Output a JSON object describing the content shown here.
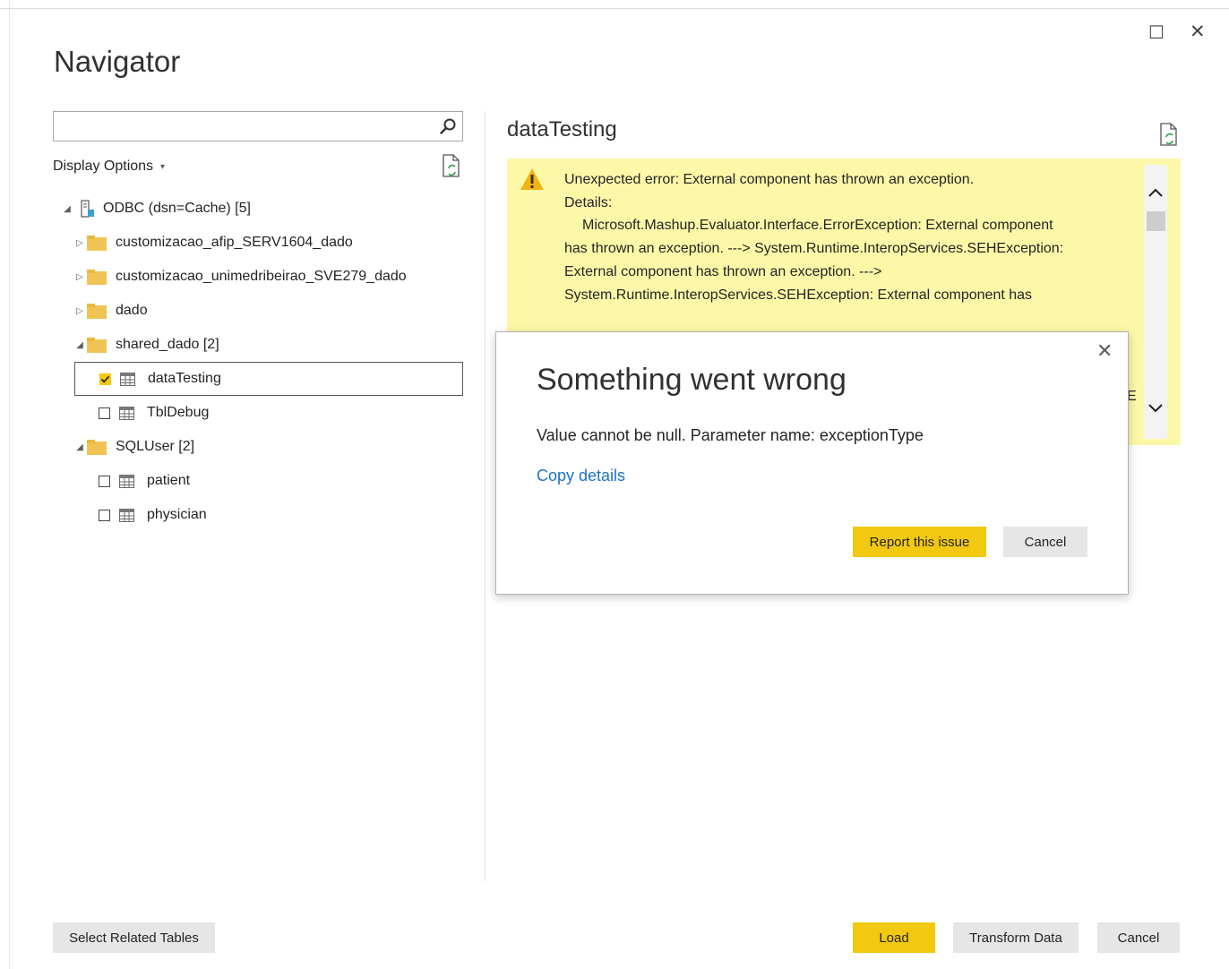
{
  "window": {
    "title": "Navigator",
    "maximize_label": "☐",
    "close_label": "✕"
  },
  "left_pane": {
    "search": {
      "value": "",
      "placeholder": ""
    },
    "display_options_label": "Display Options",
    "tree": [
      {
        "label": "ODBC (dsn=Cache) [5]",
        "kind": "source",
        "expanded": true,
        "level": 0
      },
      {
        "label": "customizacao_afip_SERV1604_dado",
        "kind": "folder",
        "expanded": false,
        "level": 1
      },
      {
        "label": "customizacao_unimedribeirao_SVE279_dado",
        "kind": "folder",
        "expanded": false,
        "level": 1
      },
      {
        "label": "dado",
        "kind": "folder",
        "expanded": false,
        "level": 1
      },
      {
        "label": "shared_dado [2]",
        "kind": "folder",
        "expanded": true,
        "level": 1
      },
      {
        "label": "dataTesting",
        "kind": "table",
        "checked": true,
        "selected": true,
        "level": 2
      },
      {
        "label": "TblDebug",
        "kind": "table",
        "checked": false,
        "level": 2
      },
      {
        "label": "SQLUser [2]",
        "kind": "folder",
        "expanded": true,
        "level": 1
      },
      {
        "label": "patient",
        "kind": "table",
        "checked": false,
        "level": 2
      },
      {
        "label": "physician",
        "kind": "table",
        "checked": false,
        "level": 2
      }
    ]
  },
  "preview": {
    "title": "dataTesting",
    "error_lines": [
      "Unexpected error: External component has thrown an exception.",
      "Details:",
      "Microsoft.Mashup.Evaluator.Interface.ErrorException: External component",
      "has thrown an exception. ---> System.Runtime.InteropServices.SEHException:",
      "External component has thrown an exception. --->",
      "System.Runtime.InteropServices.SEHException: External component has"
    ],
    "peek_char": "E"
  },
  "dialog": {
    "close_label": "✕",
    "title": "Something went wrong",
    "message": "Value cannot be null. Parameter name: exceptionType",
    "link": "Copy details",
    "report_button": "Report this issue",
    "cancel_button": "Cancel"
  },
  "footer": {
    "select_related": "Select Related Tables",
    "load": "Load",
    "transform": "Transform Data",
    "cancel": "Cancel"
  },
  "colors": {
    "accent": "#f2c811",
    "error_bg": "#fcf8a8",
    "link": "#1a73c7",
    "folder": "#f0c454"
  }
}
